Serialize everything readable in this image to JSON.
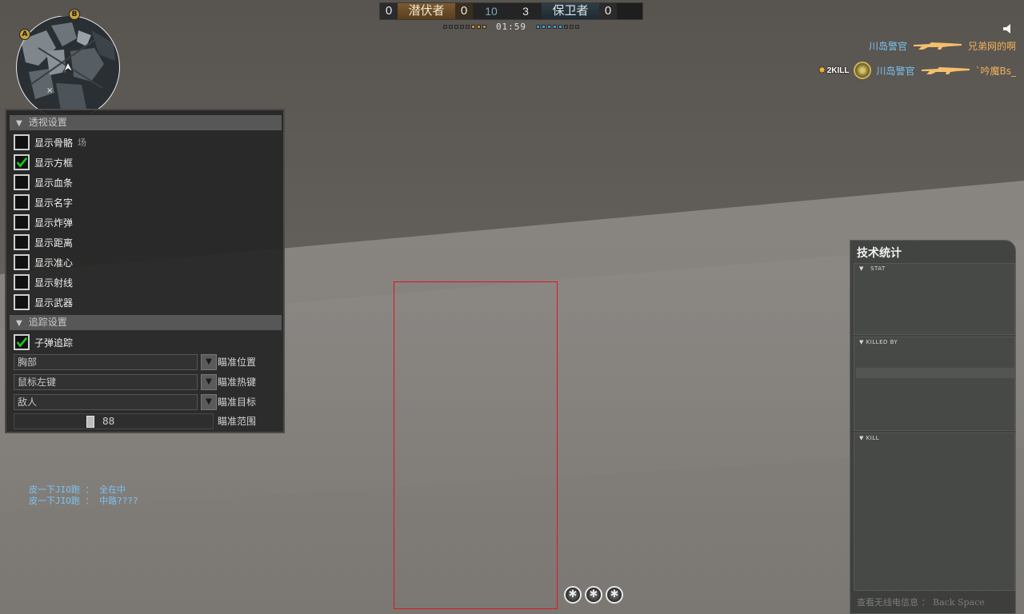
{
  "scoreboard": {
    "left_team": {
      "name": "潜伏者",
      "score": "0",
      "kills": "0"
    },
    "left_rounds": "10",
    "right_rounds": "3",
    "right_team": {
      "name": "保卫者",
      "score": "0"
    },
    "timer": "01:59",
    "left_pips_on": 3,
    "right_pips_on": 5,
    "pips_total": 8,
    "left_color": "#c88a30",
    "right_color": "#3c9ed6"
  },
  "minimap": {
    "marker_a": "A",
    "marker_b": "B"
  },
  "killfeed": [
    {
      "killer": "川岛警官",
      "weapon_icon": "rifle-icon",
      "victim": "兄弟网的啊",
      "badge": null,
      "headshot": false
    },
    {
      "killer": "川岛警官",
      "weapon_icon": "rifle-icon",
      "victim": "`吟魔Bs_",
      "badge": "2KILL",
      "headshot": true
    }
  ],
  "menu": {
    "section_esp": "透视设置",
    "esp_options": [
      {
        "label": "显示骨骼",
        "checked": false,
        "hint": "场"
      },
      {
        "label": "显示方框",
        "checked": true,
        "hint": ""
      },
      {
        "label": "显示血条",
        "checked": false,
        "hint": ""
      },
      {
        "label": "显示名字",
        "checked": false,
        "hint": ""
      },
      {
        "label": "显示炸弹",
        "checked": false,
        "hint": ""
      },
      {
        "label": "显示距离",
        "checked": false,
        "hint": ""
      },
      {
        "label": "显示准心",
        "checked": false,
        "hint": ""
      },
      {
        "label": "显示射线",
        "checked": false,
        "hint": ""
      },
      {
        "label": "显示武器",
        "checked": false,
        "hint": ""
      }
    ],
    "section_aim": "追踪设置",
    "aim_toggle": {
      "label": "子弹追踪",
      "checked": true
    },
    "dropdowns": [
      {
        "value": "胸部",
        "label": "瞄准位置"
      },
      {
        "value": "鼠标左键",
        "label": "瞄准热键"
      },
      {
        "value": "敌人",
        "label": "瞄准目标"
      }
    ],
    "slider": {
      "value": "88",
      "label": "瞄准范围",
      "fraction": 0.38
    },
    "check_color": "#19c819"
  },
  "chat": [
    "皮一下JIO跑 ： 全在中",
    "皮一下JIO跑 ： 中路????"
  ],
  "stats": {
    "title": "技术统计",
    "stat_label": "STAT",
    "killed_by_label": "KILLED BY",
    "kill_label": "KILL",
    "footer": "查看无线电信息 ： Back Space"
  },
  "esp_color": "#e0141e"
}
